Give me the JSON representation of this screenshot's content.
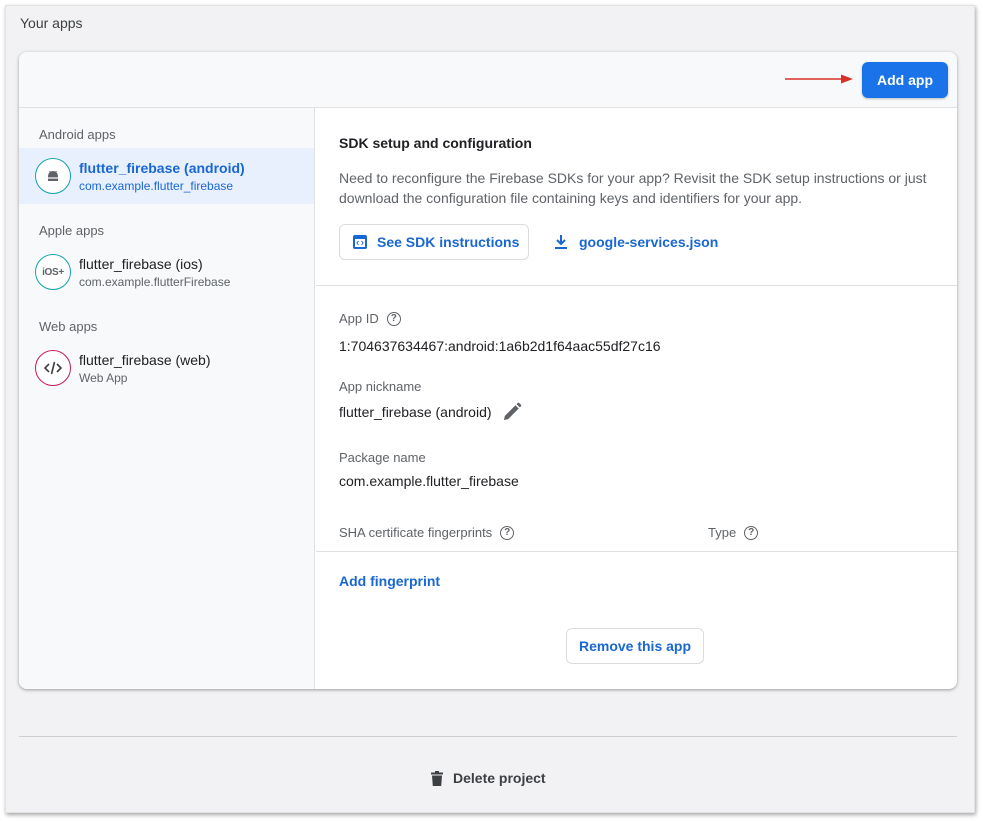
{
  "section": {
    "title": "Your apps"
  },
  "header": {
    "add_app_label": "Add app"
  },
  "colors": {
    "accent": "#1a73e8",
    "link": "#1967d2",
    "arrow": "#d93025"
  },
  "sidebar": {
    "groups": [
      {
        "label": "Android apps",
        "app": {
          "name": "flutter_firebase (android)",
          "sub": "com.example.flutter_firebase",
          "icon": "android-icon"
        }
      },
      {
        "label": "Apple apps",
        "app": {
          "name": "flutter_firebase (ios)",
          "sub": "com.example.flutterFirebase",
          "icon": "ios-icon",
          "icon_text": "iOS+"
        }
      },
      {
        "label": "Web apps",
        "app": {
          "name": "flutter_firebase (web)",
          "sub": "Web App",
          "icon": "code-icon"
        }
      }
    ]
  },
  "sdk": {
    "title": "SDK setup and configuration",
    "description": "Need to reconfigure the Firebase SDKs for your app? Revisit the SDK setup instructions or just download the configuration file containing keys and identifiers for your app.",
    "instructions_label": "See SDK instructions",
    "download_label": "google-services.json"
  },
  "details": {
    "app_id_label": "App ID",
    "app_id_value": "1:704637634467:android:1a6b2d1f64aac55df27c16",
    "nickname_label": "App nickname",
    "nickname_value": "flutter_firebase (android)",
    "package_label": "Package name",
    "package_value": "com.example.flutter_firebase",
    "sha_label": "SHA certificate fingerprints",
    "type_label": "Type",
    "add_fingerprint_label": "Add fingerprint",
    "remove_label": "Remove this app",
    "help_glyph": "?"
  },
  "footer": {
    "delete_label": "Delete project"
  }
}
